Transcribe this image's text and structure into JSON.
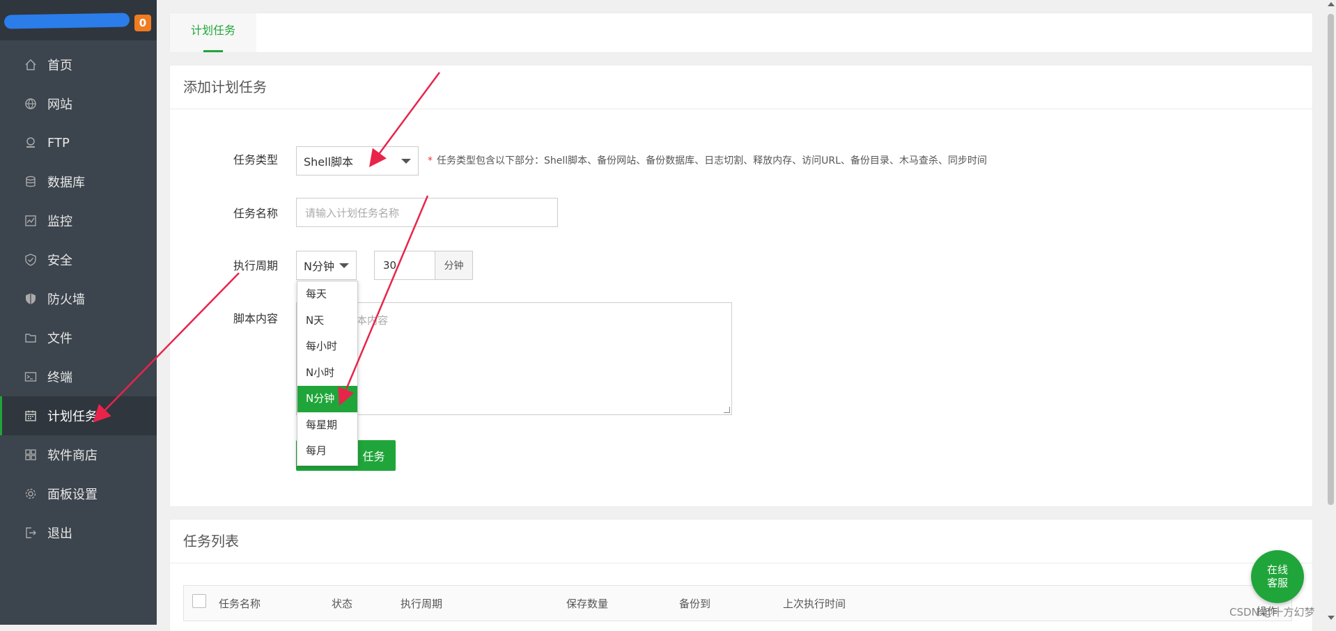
{
  "sidebar": {
    "badge": "0",
    "items": [
      {
        "label": "首页",
        "icon": "home-icon"
      },
      {
        "label": "网站",
        "icon": "globe-icon"
      },
      {
        "label": "FTP",
        "icon": "ftp-icon"
      },
      {
        "label": "数据库",
        "icon": "database-icon"
      },
      {
        "label": "监控",
        "icon": "monitor-icon"
      },
      {
        "label": "安全",
        "icon": "shield-check-icon"
      },
      {
        "label": "防火墙",
        "icon": "firewall-icon"
      },
      {
        "label": "文件",
        "icon": "folder-icon"
      },
      {
        "label": "终端",
        "icon": "terminal-icon"
      },
      {
        "label": "计划任务",
        "icon": "calendar-icon"
      },
      {
        "label": "软件商店",
        "icon": "grid-icon"
      },
      {
        "label": "面板设置",
        "icon": "gear-icon"
      },
      {
        "label": "退出",
        "icon": "logout-icon"
      }
    ],
    "active_index": 9
  },
  "tabs": {
    "active": "计划任务"
  },
  "form": {
    "title": "添加计划任务",
    "task_type_label": "任务类型",
    "task_type_value": "Shell脚本",
    "task_type_hint": "任务类型包含以下部分：Shell脚本、备份网站、备份数据库、日志切割、释放内存、访问URL、备份目录、木马查杀、同步时间",
    "task_name_label": "任务名称",
    "task_name_placeholder": "请输入计划任务名称",
    "cycle_label": "执行周期",
    "cycle_value": "N分钟",
    "cycle_number": "30",
    "cycle_unit": "分钟",
    "script_label": "脚本内容",
    "script_placeholder_visible": "本内容",
    "submit_visible": "任务",
    "cycle_options": [
      "每天",
      "N天",
      "每小时",
      "N小时",
      "N分钟",
      "每星期",
      "每月"
    ],
    "cycle_selected_index": 4
  },
  "list": {
    "title": "任务列表",
    "columns": [
      "任务名称",
      "状态",
      "执行周期",
      "保存数量",
      "备份到",
      "上次执行时间",
      "操作"
    ]
  },
  "support_button": {
    "line1": "在线",
    "line2": "客服"
  },
  "watermark": "CSDN @十方幻梦",
  "colors": {
    "accent": "#20a53a",
    "sidebar": "#3c444d",
    "badge": "#f07c21",
    "arrow": "#e8244b"
  }
}
